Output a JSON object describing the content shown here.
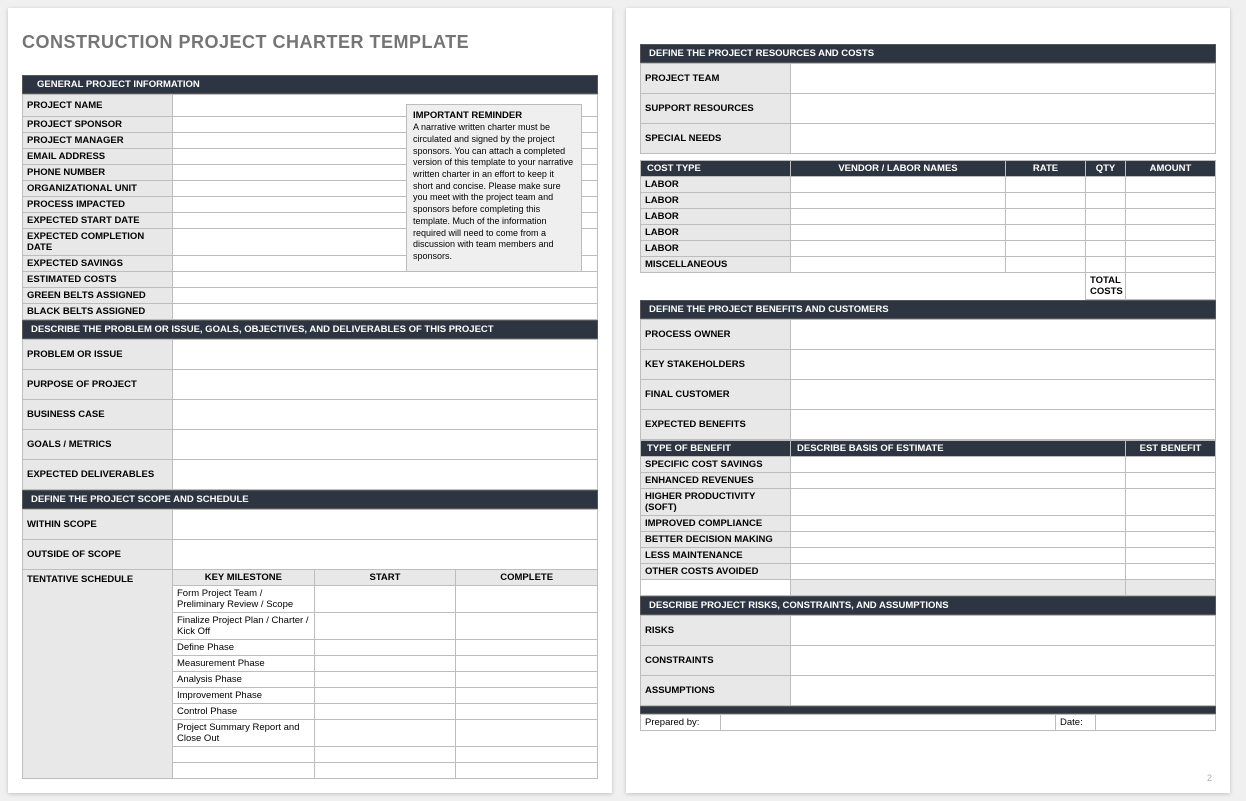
{
  "title": "CONSTRUCTION PROJECT CHARTER TEMPLATE",
  "sections": {
    "general": "GENERAL PROJECT INFORMATION",
    "describe": "DESCRIBE THE PROBLEM OR ISSUE, GOALS, OBJECTIVES, AND DELIVERABLES OF THIS PROJECT",
    "scope": "DEFINE THE PROJECT SCOPE AND SCHEDULE",
    "resources": "DEFINE THE PROJECT RESOURCES AND COSTS",
    "benefits": "DEFINE THE PROJECT BENEFITS AND CUSTOMERS",
    "risks": "DESCRIBE PROJECT RISKS, CONSTRAINTS, AND ASSUMPTIONS"
  },
  "general_info_labels": [
    "PROJECT NAME",
    "PROJECT SPONSOR",
    "PROJECT MANAGER",
    "EMAIL ADDRESS",
    "PHONE NUMBER",
    "ORGANIZATIONAL UNIT",
    "PROCESS IMPACTED",
    "EXPECTED START DATE",
    "EXPECTED COMPLETION DATE",
    "EXPECTED SAVINGS",
    "ESTIMATED COSTS",
    "GREEN BELTS ASSIGNED",
    "BLACK BELTS ASSIGNED"
  ],
  "describe_labels": [
    "PROBLEM OR ISSUE",
    "PURPOSE OF PROJECT",
    "BUSINESS CASE",
    "GOALS / METRICS",
    "EXPECTED DELIVERABLES"
  ],
  "scope_labels": {
    "within": "WITHIN SCOPE",
    "outside": "OUTSIDE OF  SCOPE",
    "tentative": "TENTATIVE SCHEDULE"
  },
  "milestone_headers": {
    "key": "KEY MILESTONE",
    "start": "START",
    "complete": "COMPLETE"
  },
  "milestones": [
    "Form Project Team / Preliminary Review / Scope",
    "Finalize Project Plan / Charter / Kick Off",
    "Define Phase",
    "Measurement Phase",
    "Analysis Phase",
    "Improvement Phase",
    "Control Phase",
    "Project Summary Report and Close Out",
    "",
    ""
  ],
  "reminder": {
    "title": "IMPORTANT REMINDER",
    "body": "A narrative written charter must be circulated and signed by the project sponsors. You can attach a completed version of this template to your narrative written charter in an effort to keep it short and concise. Please make sure you meet with the project team and sponsors before completing this template. Much of the information required will need to come from a discussion with team members and sponsors."
  },
  "resources_labels": [
    "PROJECT TEAM",
    "SUPPORT RESOURCES",
    "SPECIAL NEEDS"
  ],
  "cost_headers": {
    "type": "COST TYPE",
    "vendor": "VENDOR / LABOR NAMES",
    "rate": "RATE",
    "qty": "QTY",
    "amount": "AMOUNT"
  },
  "cost_rows": [
    "LABOR",
    "LABOR",
    "LABOR",
    "LABOR",
    "LABOR",
    "MISCELLANEOUS"
  ],
  "total_costs_label": "TOTAL COSTS",
  "benefits_labels": [
    "PROCESS OWNER",
    "KEY STAKEHOLDERS",
    "FINAL CUSTOMER",
    "EXPECTED BENEFITS"
  ],
  "benefit_headers": {
    "type": "TYPE OF BENEFIT",
    "basis": "DESCRIBE BASIS OF ESTIMATE",
    "est": "EST BENEFIT"
  },
  "benefit_rows": [
    "SPECIFIC COST SAVINGS",
    "ENHANCED REVENUES",
    "HIGHER PRODUCTIVITY (SOFT)",
    "IMPROVED COMPLIANCE",
    "BETTER DECISION MAKING",
    "LESS MAINTENANCE",
    "OTHER COSTS AVOIDED"
  ],
  "risks_labels": [
    "RISKS",
    "CONSTRAINTS",
    "ASSUMPTIONS"
  ],
  "signoff": {
    "prepared_by": "Prepared by:",
    "date": "Date:"
  },
  "page_number": "2"
}
